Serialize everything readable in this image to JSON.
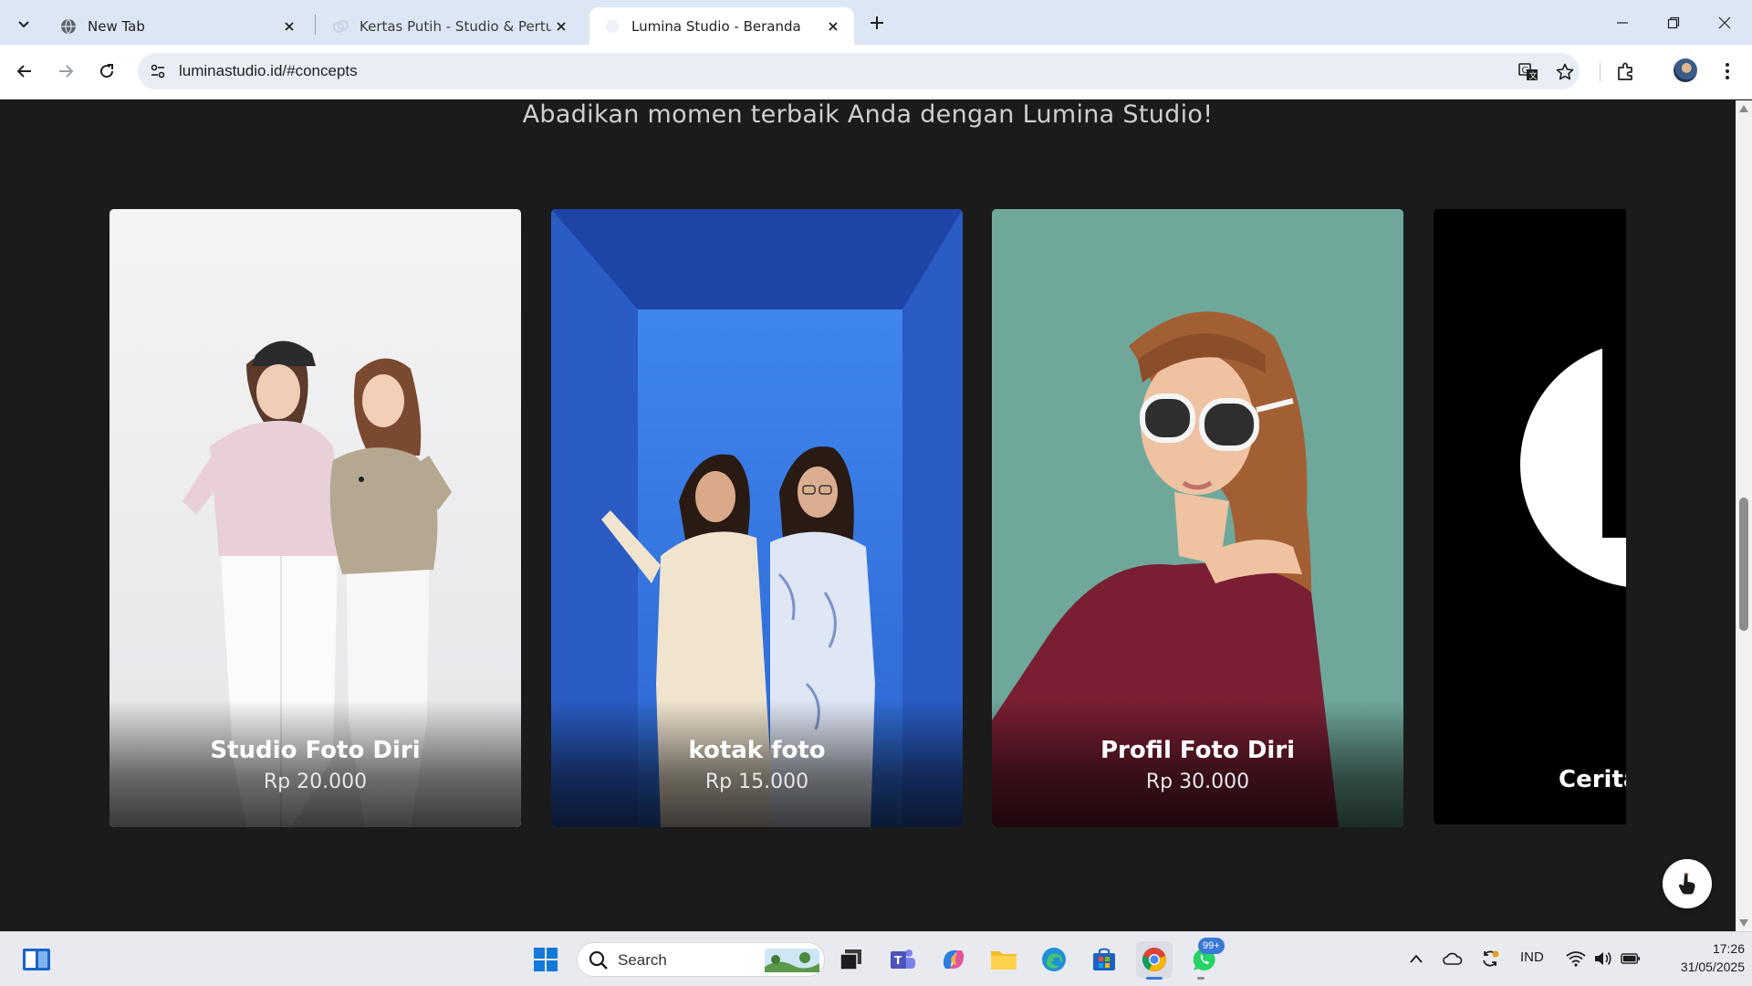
{
  "browser": {
    "tabs": [
      {
        "title": "New Tab",
        "active": false,
        "favicon": "globe-icon"
      },
      {
        "title": "Kertas Putih - Studio & Pertunangan",
        "active": false,
        "favicon": "ring-icon"
      },
      {
        "title": "Lumina Studio - Beranda",
        "active": true,
        "favicon": "page-icon"
      }
    ],
    "url": "luminastudio.id/#concepts"
  },
  "page": {
    "tagline": "Abadikan momen terbaik Anda dengan Lumina Studio!",
    "cards": [
      {
        "name": "Studio Foto Diri",
        "price": "Rp 20.000"
      },
      {
        "name": "kotak foto",
        "price": "Rp 15.000"
      },
      {
        "name": "Profil Foto Diri",
        "price": "Rp 30.000"
      },
      {
        "name": "Cerita"
      }
    ]
  },
  "taskbar": {
    "search_label": "Search",
    "whatsapp_badge": "99+",
    "language": "IND",
    "time": "17:26",
    "date": "31/05/2025"
  },
  "colors": {
    "page_background": "#1b1b1b",
    "tab_strip": "#dde6f5",
    "card_blue": "#2f6fdc",
    "card_teal": "#6fa79a"
  }
}
